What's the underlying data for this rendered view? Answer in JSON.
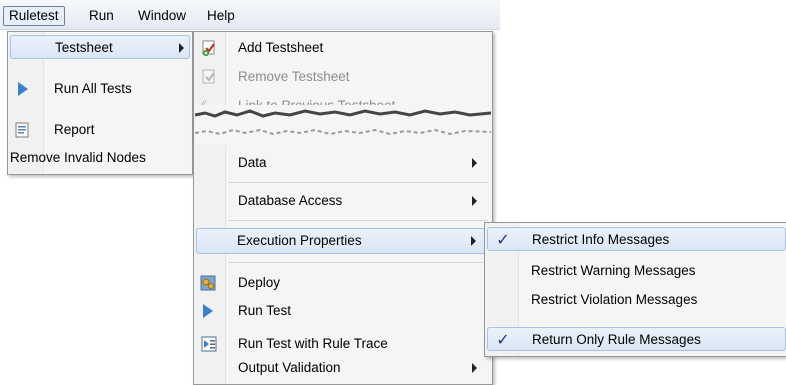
{
  "menubar": {
    "items": [
      "Ruletest",
      "Run",
      "Window",
      "Help"
    ]
  },
  "main_menu": {
    "items": [
      {
        "label": "Testsheet",
        "icon": "",
        "submenu": true
      },
      {
        "label": "Run All Tests",
        "icon": "run-icon"
      },
      {
        "label": "Report",
        "icon": "report-icon"
      },
      {
        "label": "Remove Invalid Nodes",
        "icon": ""
      }
    ]
  },
  "testsheet_menu": {
    "items": [
      {
        "label": "Add Testsheet",
        "icon": "add-testsheet-icon"
      },
      {
        "label": "Remove Testsheet",
        "icon": "remove-testsheet-icon",
        "disabled": true
      },
      {
        "label": "Link to Previous Testsheet",
        "icon": "link-icon",
        "disabled": true
      },
      {
        "label": "Data",
        "submenu": true
      },
      {
        "label": "Database Access",
        "submenu": true
      },
      {
        "label": "Execution Properties",
        "submenu": true
      },
      {
        "label": "Deploy",
        "icon": "deploy-icon"
      },
      {
        "label": "Run Test",
        "icon": "run-icon"
      },
      {
        "label": "Run Test with Rule Trace",
        "icon": "rule-trace-icon"
      },
      {
        "label": "Output Validation",
        "submenu": true
      }
    ]
  },
  "execution_menu": {
    "items": [
      {
        "label": "Restrict Info Messages",
        "checked": true
      },
      {
        "label": "Restrict Warning Messages",
        "checked": false
      },
      {
        "label": "Restrict Violation Messages",
        "checked": false
      },
      {
        "label": "Return Only Rule Messages",
        "checked": true
      }
    ]
  },
  "colors": {
    "highlight": "#dbe6f5",
    "play": "#3b7fd0",
    "check": "#1a3a8a"
  }
}
